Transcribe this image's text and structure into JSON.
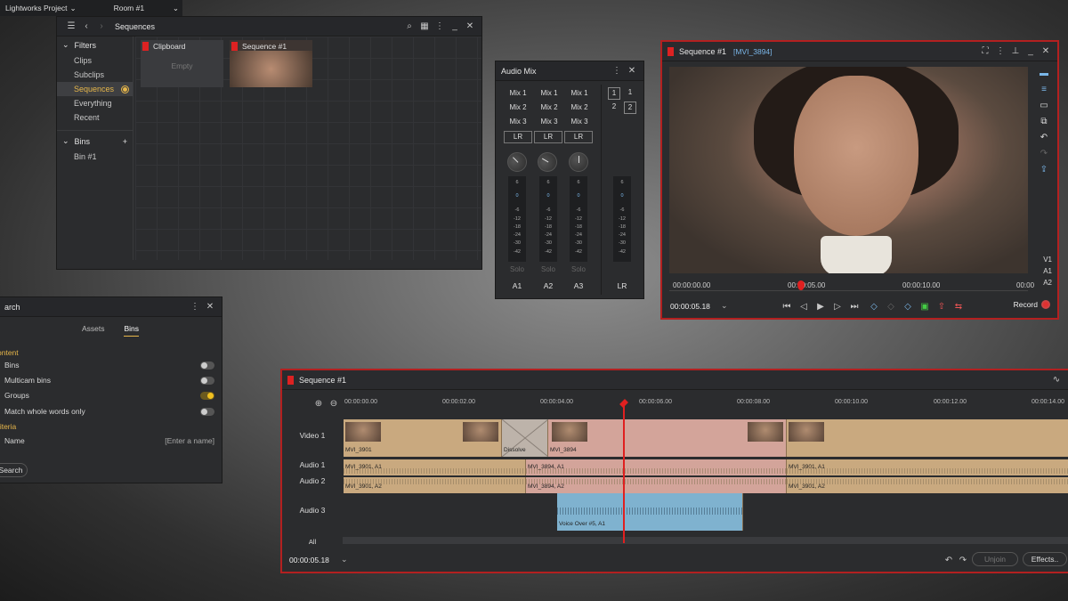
{
  "project_bar": {
    "project": "Lightworks Project",
    "room": "Room #1"
  },
  "sequences_panel": {
    "title": "Sequences",
    "filters_label": "Filters",
    "filters": [
      "Clips",
      "Subclips",
      "Sequences",
      "Everything",
      "Recent"
    ],
    "selected_filter": "Sequences",
    "bins_label": "Bins",
    "bins": [
      "Bin #1"
    ],
    "tiles": [
      {
        "label": "Clipboard",
        "sub": "Empty"
      },
      {
        "label": "Sequence #1"
      }
    ]
  },
  "audio_mix": {
    "title": "Audio Mix",
    "mix_rows": [
      [
        "Mix 1",
        "Mix 1",
        "Mix 1"
      ],
      [
        "Mix 2",
        "Mix 2",
        "Mix 2"
      ],
      [
        "Mix 3",
        "Mix 3",
        "Mix 3"
      ]
    ],
    "lr": "LR",
    "selectors": [
      "1",
      "1",
      "2",
      "2"
    ],
    "scale": [
      "6",
      "0",
      "-6",
      "-12",
      "-18",
      "-24",
      "-30",
      "-42"
    ],
    "solo": "Solo",
    "channels": [
      "A1",
      "A2",
      "A3",
      "LR"
    ]
  },
  "viewer": {
    "title": "Sequence #1",
    "clip": "[MVI_3894]",
    "timecodes": [
      "00:00:00.00",
      "00:00:05.00",
      "00:00:10.00",
      "00:00"
    ],
    "current": "00:00:05.18",
    "tracks": [
      "V1",
      "A1",
      "A2"
    ],
    "record_label": "Record"
  },
  "search_panel": {
    "title": "arch",
    "tabs": [
      "Assets",
      "Bins"
    ],
    "active_tab": "Bins",
    "content_label": "ontent",
    "options": [
      {
        "label": "Bins",
        "on": false
      },
      {
        "label": "Multicam bins",
        "on": false
      },
      {
        "label": "Groups",
        "on": true
      },
      {
        "label": "Match whole words only",
        "on": false
      }
    ],
    "criteria_label": "riteria",
    "name_label": "Name",
    "name_placeholder": "[Enter a name]",
    "search_button": "Search"
  },
  "timeline": {
    "title": "Sequence #1",
    "ruler": [
      "00:00:00.00",
      "00:00:02.00",
      "00:00:04.00",
      "00:00:06.00",
      "00:00:08.00",
      "00:00:10.00",
      "00:00:12.00",
      "00:00:14.00"
    ],
    "tracks": [
      "Video 1",
      "Audio 1",
      "Audio 2",
      "Audio 3",
      "All"
    ],
    "clips": {
      "v1": [
        "MVI_3901",
        "Dissolve",
        "MVI_3894"
      ],
      "a1": [
        "MVI_3901, A1",
        "MVI_3894, A1",
        "MVI_3901, A1"
      ],
      "a2": [
        "MVI_3901, A2",
        "MVI_3894, A2",
        "MVI_3901, A2"
      ],
      "a3": [
        "Voice Over #5, A1"
      ]
    },
    "current": "00:00:05.18",
    "unjoin": "Unjoin",
    "effects": "Effects.."
  },
  "colors": {
    "accent": "#e6b64a",
    "record": "#b32020",
    "audio_clip": "#c9a97f",
    "voice_clip": "#7fb2cf"
  }
}
